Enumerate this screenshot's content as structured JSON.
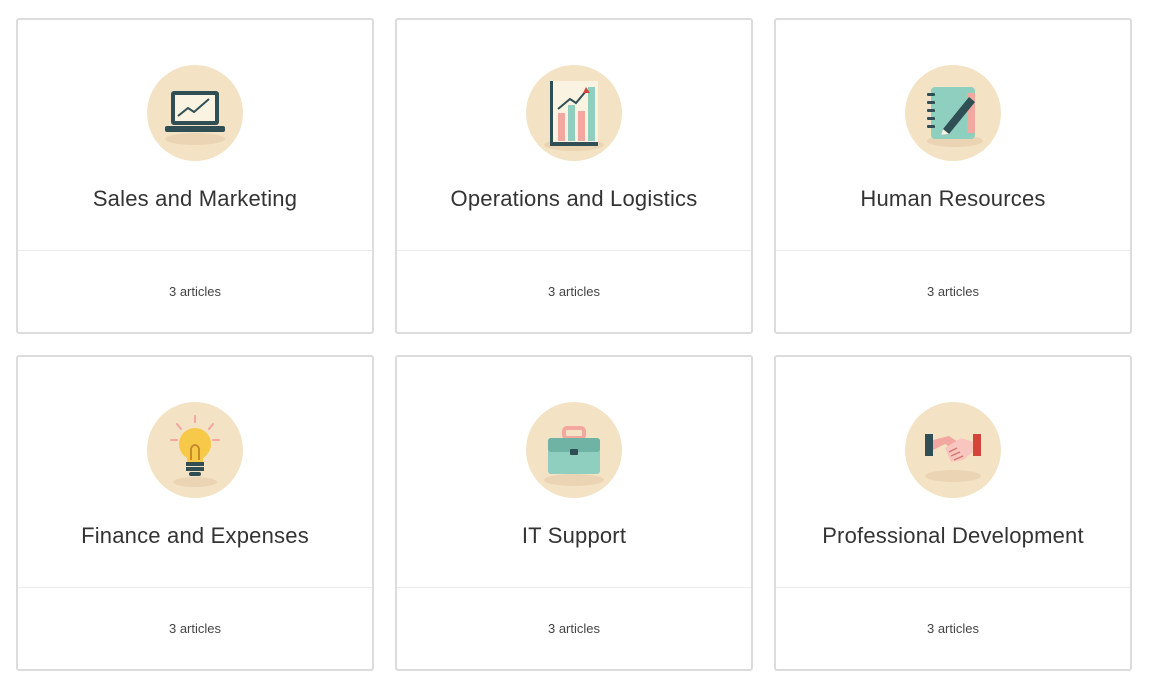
{
  "categories": [
    {
      "title": "Sales and Marketing",
      "count": "3 articles",
      "icon": "laptop-chart-icon"
    },
    {
      "title": "Operations and Logistics",
      "count": "3 articles",
      "icon": "bar-chart-icon"
    },
    {
      "title": "Human Resources",
      "count": "3 articles",
      "icon": "notebook-pen-icon"
    },
    {
      "title": "Finance and Expenses",
      "count": "3 articles",
      "icon": "lightbulb-icon"
    },
    {
      "title": "IT Support",
      "count": "3 articles",
      "icon": "briefcase-icon"
    },
    {
      "title": "Professional Development",
      "count": "3 articles",
      "icon": "handshake-icon"
    }
  ],
  "colors": {
    "circle": "#f3e3c4",
    "teal": "#8fcfc0",
    "dark": "#2f4f55",
    "pink": "#f2a7a0",
    "yellow": "#f7c948"
  }
}
